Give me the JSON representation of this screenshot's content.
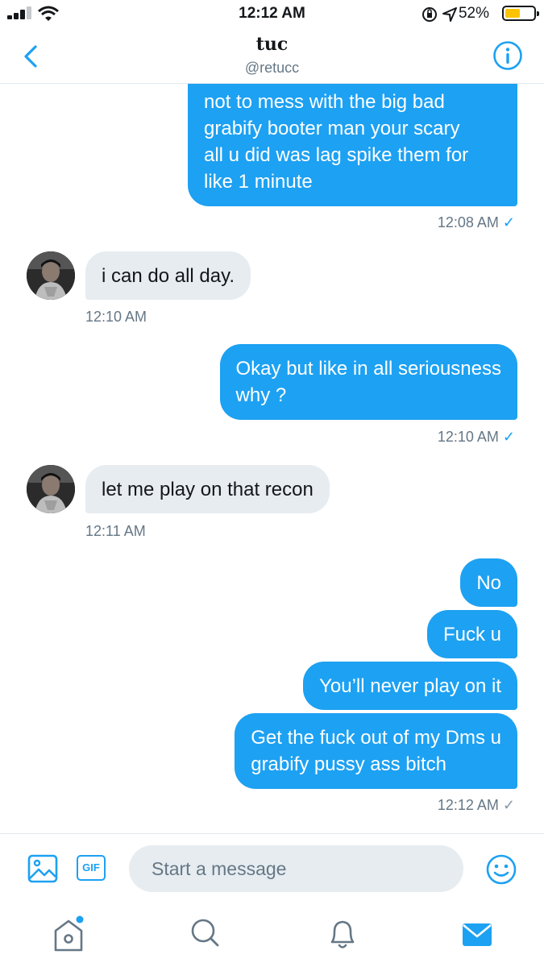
{
  "status_bar": {
    "time": "12:12 AM",
    "battery_percent": "52%",
    "battery_level": 0.52
  },
  "header": {
    "name": "tuc",
    "handle": "@retucc",
    "back_icon": "chevron-left-icon",
    "info_icon": "info-icon"
  },
  "messages": [
    {
      "direction": "out",
      "lines": [
        "not to mess with the big bad",
        "grabify booter man your scary",
        "all u did was lag spike them for",
        "like 1 minute"
      ]
    },
    {
      "direction": "out",
      "timestamp": "12:08 AM",
      "status": "✓"
    },
    {
      "direction": "in",
      "text": "i can do all day.",
      "timestamp": "12:10 AM"
    },
    {
      "direction": "out",
      "lines": [
        "Okay but like in all seriousness",
        "why ?"
      ],
      "timestamp": "12:10 AM",
      "status": "✓"
    },
    {
      "direction": "in",
      "text": "let me play on that recon",
      "timestamp": "12:11 AM"
    },
    {
      "direction": "out",
      "text": "No"
    },
    {
      "direction": "out",
      "text": "Fuck u"
    },
    {
      "direction": "out",
      "text": "You’ll never play on it"
    },
    {
      "direction": "out",
      "lines": [
        "Get the fuck out of my Dms u",
        "grabify pussy ass bitch"
      ],
      "timestamp": "12:12 AM",
      "status": "✓"
    }
  ],
  "composer": {
    "placeholder": "Start a message",
    "gif_label": "GIF",
    "media_icon": "image-icon",
    "emoji_icon": "smiley-icon"
  },
  "tabbar": {
    "items": [
      "home-icon",
      "search-icon",
      "bell-icon",
      "mail-icon"
    ],
    "active": "mail-icon"
  },
  "colors": {
    "accent": "#1da1f2",
    "incoming_bubble": "#e6ecf0",
    "muted_text": "#657786",
    "battery": "#fcc400"
  }
}
